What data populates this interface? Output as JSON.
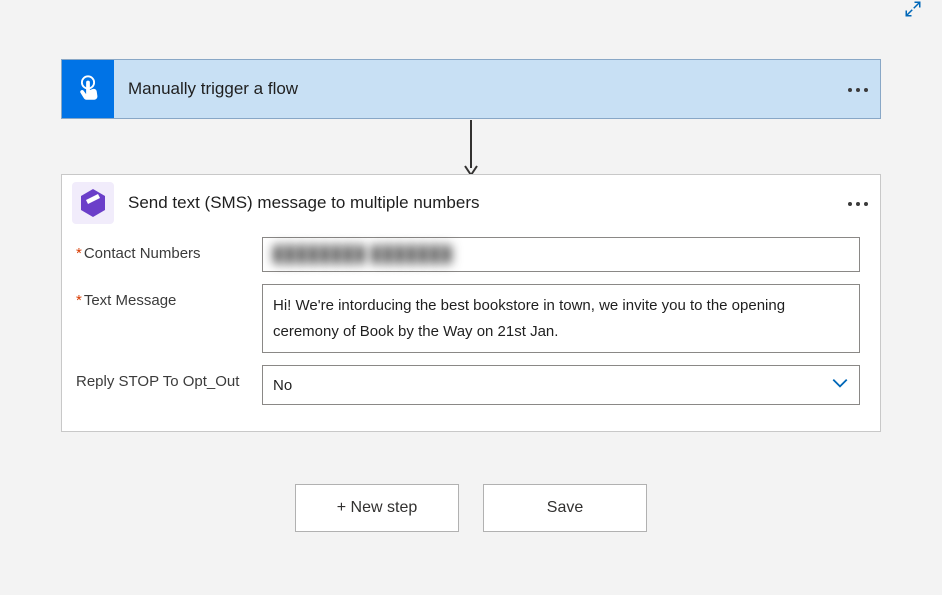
{
  "trigger": {
    "title": "Manually trigger a flow",
    "icon": "touch-pointer-icon"
  },
  "action": {
    "title": "Send text (SMS) message to multiple numbers",
    "icon": "txtsync-icon",
    "fields": {
      "contact_numbers": {
        "label": "Contact Numbers",
        "required": true,
        "value": "████████  ███████"
      },
      "text_message": {
        "label": "Text Message",
        "required": true,
        "value": "Hi! We're intorducing the best bookstore in town, we invite you to the opening ceremony of Book by the Way on 21st Jan."
      },
      "reply_stop": {
        "label": "Reply STOP To Opt_Out",
        "required": false,
        "value": "No"
      }
    }
  },
  "footer": {
    "new_step": "+ New step",
    "save": "Save"
  }
}
